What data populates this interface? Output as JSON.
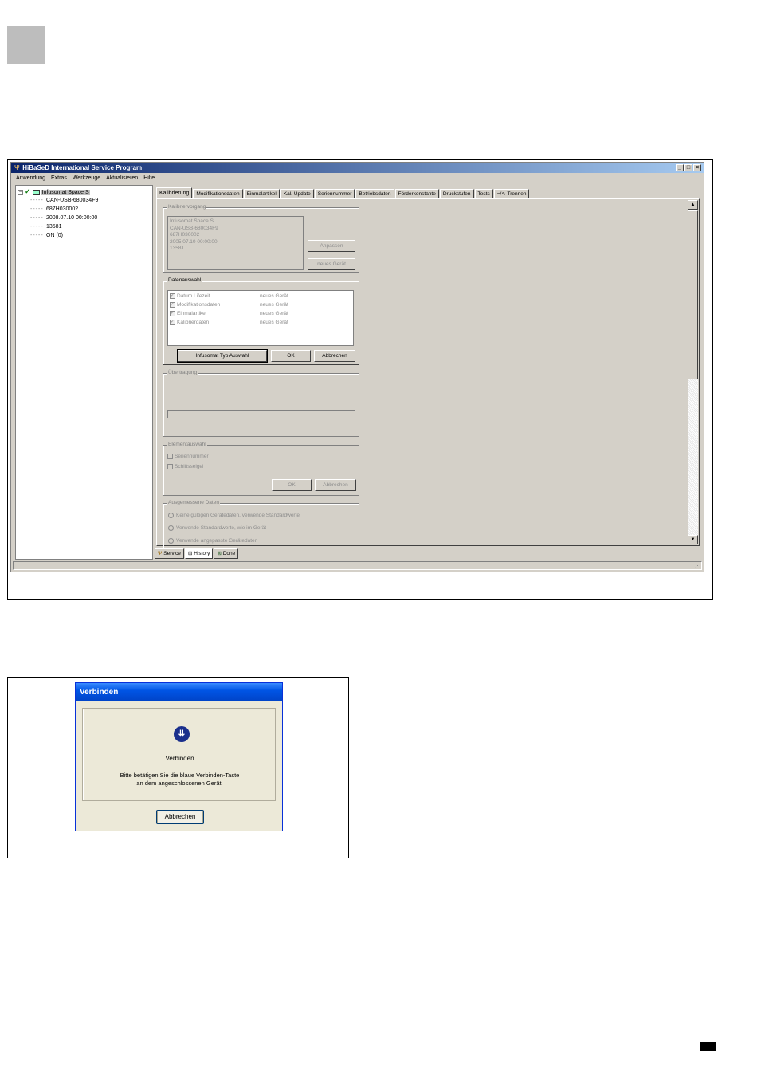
{
  "window": {
    "title": "HiBaSeD International Service Program"
  },
  "menu": [
    "Anwendung",
    "Extras",
    "Werkzeuge",
    "Aktualisieren",
    "Hilfe"
  ],
  "tree": {
    "root": "Infusomat Space S",
    "children": [
      "CAN-USB-680034F9",
      "687H030002",
      "2008.07.10 00:00:00",
      "13581",
      "ON (0)"
    ]
  },
  "tabs": [
    "Kalibrierung",
    "Modifikationsdaten",
    "Einmalartikel",
    "Kal. Update",
    "Seriennummer",
    "Betriebsdaten",
    "Förderkonstante",
    "Druckstufen",
    "Tests",
    "Trennen"
  ],
  "kalibriervorgang": {
    "title": "Kalibriervorgang",
    "info_lines": [
      "Infusomat Space S",
      "CAN-USB-680034F9",
      "687H030002",
      "2005.07.10 00:00:00",
      "13581"
    ],
    "btn_anpassen": "Anpassen",
    "btn_neues_geraet": "neues Gerät"
  },
  "datenauswahl": {
    "title": "Datenauswahl",
    "rows": [
      {
        "label": "Datum Lifezeit",
        "value": "neues Gerät"
      },
      {
        "label": "Modifikationsdaten",
        "value": "neues Gerät"
      },
      {
        "label": "Einmalartikel",
        "value": "neues Gerät"
      },
      {
        "label": "Kalibrierdaten",
        "value": "neues Gerät"
      }
    ],
    "btn_typ": "Infusomat Typ Auswahl",
    "btn_ok": "OK",
    "btn_abbrechen": "Abbrechen"
  },
  "uebertragung": {
    "title": "Übertragung"
  },
  "elementauswahl": {
    "title": "Elementauswahl",
    "opt1": "Seriennummer",
    "opt2": "Schlüsselgel",
    "btn_ok": "OK",
    "btn_abbrechen": "Abbrechen"
  },
  "ausgemessene": {
    "title": "Ausgemessene Daten",
    "opts": [
      "Keine gültigen Gerätedaten, verwende Standardwerte",
      "Verwende Standardwerte, wie im Gerät",
      "Verwende angepasste Gerätedaten"
    ]
  },
  "bottom_tabs": [
    "Service",
    "History",
    "Done"
  ],
  "dialog": {
    "title": "Verbinden",
    "heading": "Verbinden",
    "line1": "Bitte betätigen Sie die blaue Verbinden-Taste",
    "line2": "an dem angeschlossenen Gerät.",
    "btn": "Abbrechen"
  }
}
